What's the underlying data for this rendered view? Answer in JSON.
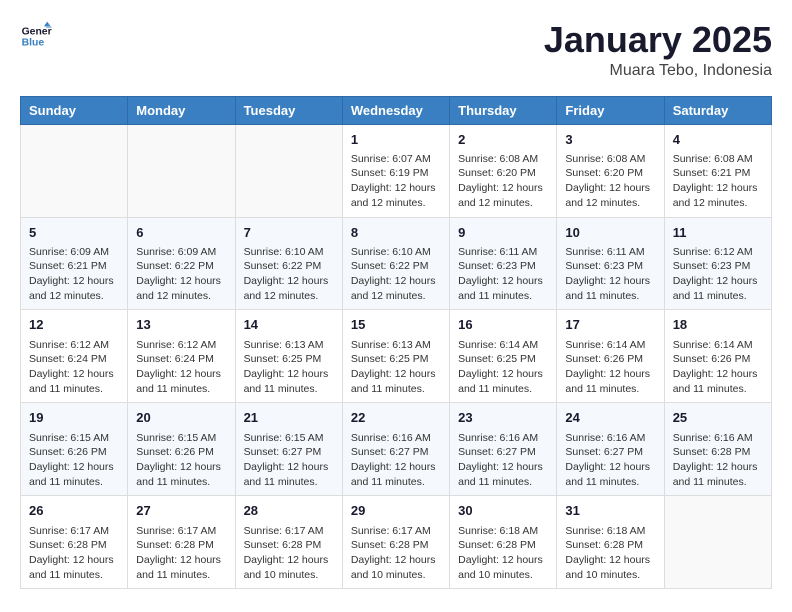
{
  "header": {
    "logo_line1": "General",
    "logo_line2": "Blue",
    "month_title": "January 2025",
    "location": "Muara Tebo, Indonesia"
  },
  "weekdays": [
    "Sunday",
    "Monday",
    "Tuesday",
    "Wednesday",
    "Thursday",
    "Friday",
    "Saturday"
  ],
  "weeks": [
    [
      {
        "day": "",
        "sunrise": "",
        "sunset": "",
        "daylight": ""
      },
      {
        "day": "",
        "sunrise": "",
        "sunset": "",
        "daylight": ""
      },
      {
        "day": "",
        "sunrise": "",
        "sunset": "",
        "daylight": ""
      },
      {
        "day": "1",
        "sunrise": "Sunrise: 6:07 AM",
        "sunset": "Sunset: 6:19 PM",
        "daylight": "Daylight: 12 hours and 12 minutes."
      },
      {
        "day": "2",
        "sunrise": "Sunrise: 6:08 AM",
        "sunset": "Sunset: 6:20 PM",
        "daylight": "Daylight: 12 hours and 12 minutes."
      },
      {
        "day": "3",
        "sunrise": "Sunrise: 6:08 AM",
        "sunset": "Sunset: 6:20 PM",
        "daylight": "Daylight: 12 hours and 12 minutes."
      },
      {
        "day": "4",
        "sunrise": "Sunrise: 6:08 AM",
        "sunset": "Sunset: 6:21 PM",
        "daylight": "Daylight: 12 hours and 12 minutes."
      }
    ],
    [
      {
        "day": "5",
        "sunrise": "Sunrise: 6:09 AM",
        "sunset": "Sunset: 6:21 PM",
        "daylight": "Daylight: 12 hours and 12 minutes."
      },
      {
        "day": "6",
        "sunrise": "Sunrise: 6:09 AM",
        "sunset": "Sunset: 6:22 PM",
        "daylight": "Daylight: 12 hours and 12 minutes."
      },
      {
        "day": "7",
        "sunrise": "Sunrise: 6:10 AM",
        "sunset": "Sunset: 6:22 PM",
        "daylight": "Daylight: 12 hours and 12 minutes."
      },
      {
        "day": "8",
        "sunrise": "Sunrise: 6:10 AM",
        "sunset": "Sunset: 6:22 PM",
        "daylight": "Daylight: 12 hours and 12 minutes."
      },
      {
        "day": "9",
        "sunrise": "Sunrise: 6:11 AM",
        "sunset": "Sunset: 6:23 PM",
        "daylight": "Daylight: 12 hours and 11 minutes."
      },
      {
        "day": "10",
        "sunrise": "Sunrise: 6:11 AM",
        "sunset": "Sunset: 6:23 PM",
        "daylight": "Daylight: 12 hours and 11 minutes."
      },
      {
        "day": "11",
        "sunrise": "Sunrise: 6:12 AM",
        "sunset": "Sunset: 6:23 PM",
        "daylight": "Daylight: 12 hours and 11 minutes."
      }
    ],
    [
      {
        "day": "12",
        "sunrise": "Sunrise: 6:12 AM",
        "sunset": "Sunset: 6:24 PM",
        "daylight": "Daylight: 12 hours and 11 minutes."
      },
      {
        "day": "13",
        "sunrise": "Sunrise: 6:12 AM",
        "sunset": "Sunset: 6:24 PM",
        "daylight": "Daylight: 12 hours and 11 minutes."
      },
      {
        "day": "14",
        "sunrise": "Sunrise: 6:13 AM",
        "sunset": "Sunset: 6:25 PM",
        "daylight": "Daylight: 12 hours and 11 minutes."
      },
      {
        "day": "15",
        "sunrise": "Sunrise: 6:13 AM",
        "sunset": "Sunset: 6:25 PM",
        "daylight": "Daylight: 12 hours and 11 minutes."
      },
      {
        "day": "16",
        "sunrise": "Sunrise: 6:14 AM",
        "sunset": "Sunset: 6:25 PM",
        "daylight": "Daylight: 12 hours and 11 minutes."
      },
      {
        "day": "17",
        "sunrise": "Sunrise: 6:14 AM",
        "sunset": "Sunset: 6:26 PM",
        "daylight": "Daylight: 12 hours and 11 minutes."
      },
      {
        "day": "18",
        "sunrise": "Sunrise: 6:14 AM",
        "sunset": "Sunset: 6:26 PM",
        "daylight": "Daylight: 12 hours and 11 minutes."
      }
    ],
    [
      {
        "day": "19",
        "sunrise": "Sunrise: 6:15 AM",
        "sunset": "Sunset: 6:26 PM",
        "daylight": "Daylight: 12 hours and 11 minutes."
      },
      {
        "day": "20",
        "sunrise": "Sunrise: 6:15 AM",
        "sunset": "Sunset: 6:26 PM",
        "daylight": "Daylight: 12 hours and 11 minutes."
      },
      {
        "day": "21",
        "sunrise": "Sunrise: 6:15 AM",
        "sunset": "Sunset: 6:27 PM",
        "daylight": "Daylight: 12 hours and 11 minutes."
      },
      {
        "day": "22",
        "sunrise": "Sunrise: 6:16 AM",
        "sunset": "Sunset: 6:27 PM",
        "daylight": "Daylight: 12 hours and 11 minutes."
      },
      {
        "day": "23",
        "sunrise": "Sunrise: 6:16 AM",
        "sunset": "Sunset: 6:27 PM",
        "daylight": "Daylight: 12 hours and 11 minutes."
      },
      {
        "day": "24",
        "sunrise": "Sunrise: 6:16 AM",
        "sunset": "Sunset: 6:27 PM",
        "daylight": "Daylight: 12 hours and 11 minutes."
      },
      {
        "day": "25",
        "sunrise": "Sunrise: 6:16 AM",
        "sunset": "Sunset: 6:28 PM",
        "daylight": "Daylight: 12 hours and 11 minutes."
      }
    ],
    [
      {
        "day": "26",
        "sunrise": "Sunrise: 6:17 AM",
        "sunset": "Sunset: 6:28 PM",
        "daylight": "Daylight: 12 hours and 11 minutes."
      },
      {
        "day": "27",
        "sunrise": "Sunrise: 6:17 AM",
        "sunset": "Sunset: 6:28 PM",
        "daylight": "Daylight: 12 hours and 11 minutes."
      },
      {
        "day": "28",
        "sunrise": "Sunrise: 6:17 AM",
        "sunset": "Sunset: 6:28 PM",
        "daylight": "Daylight: 12 hours and 10 minutes."
      },
      {
        "day": "29",
        "sunrise": "Sunrise: 6:17 AM",
        "sunset": "Sunset: 6:28 PM",
        "daylight": "Daylight: 12 hours and 10 minutes."
      },
      {
        "day": "30",
        "sunrise": "Sunrise: 6:18 AM",
        "sunset": "Sunset: 6:28 PM",
        "daylight": "Daylight: 12 hours and 10 minutes."
      },
      {
        "day": "31",
        "sunrise": "Sunrise: 6:18 AM",
        "sunset": "Sunset: 6:28 PM",
        "daylight": "Daylight: 12 hours and 10 minutes."
      },
      {
        "day": "",
        "sunrise": "",
        "sunset": "",
        "daylight": ""
      }
    ]
  ]
}
